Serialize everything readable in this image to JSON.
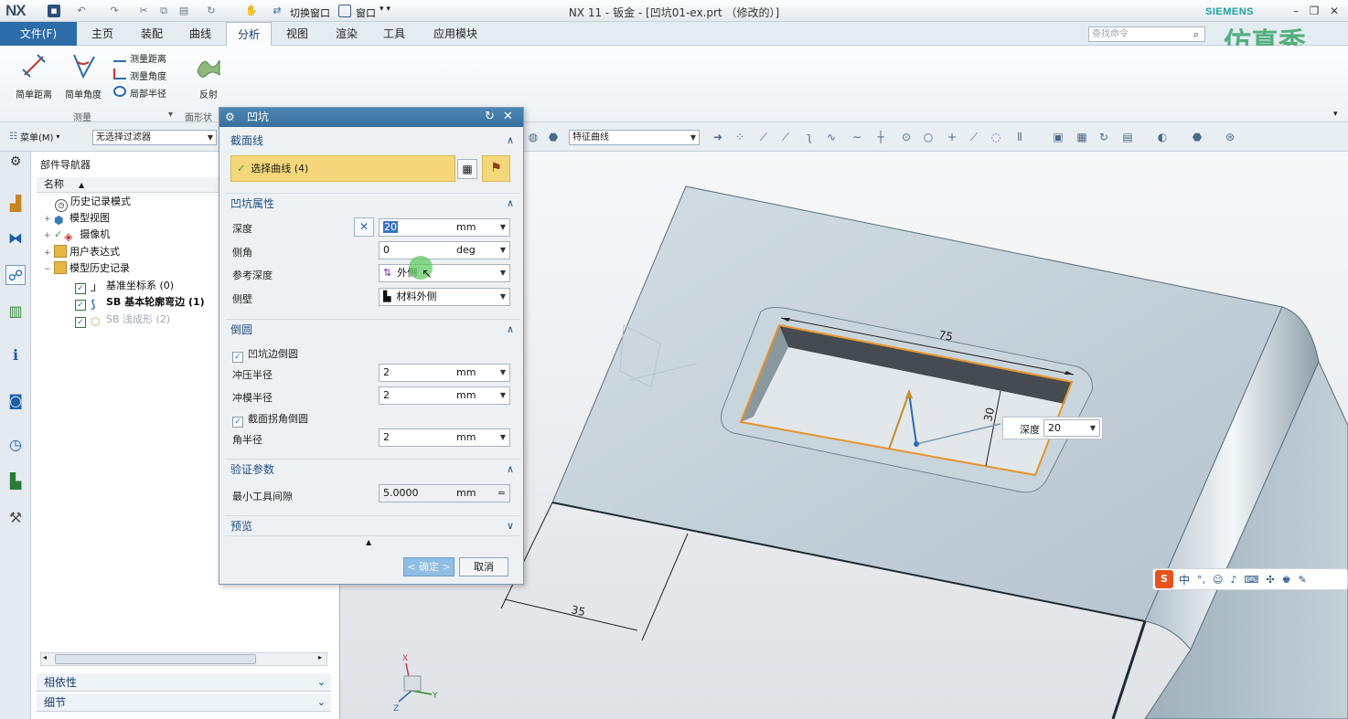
{
  "window": {
    "logo": "NX",
    "title": "NX 11 - 钣金 - [凹坑01-ex.prt （修改的）]",
    "brand": "SIEMENS",
    "watermark": "仿真秀",
    "quick_access": [
      "切换窗口",
      "窗口"
    ]
  },
  "menu": {
    "file": "文件(F)",
    "tabs": [
      "主页",
      "装配",
      "曲线",
      "分析",
      "视图",
      "渲染",
      "工具",
      "应用模块"
    ],
    "active_tab": "分析",
    "search_placeholder": "查找命令"
  },
  "ribbon": {
    "big_buttons": [
      "简单距离",
      "简单角度"
    ],
    "small_buttons": [
      "测量距离",
      "测量角度",
      "局部半径"
    ],
    "reflect_button": "反射",
    "group_measure": "测量",
    "group_shape": "面形状"
  },
  "toolbar": {
    "menu_label": "菜单(M)",
    "filter_value": "无选择过滤器",
    "curve_rule": "特征曲线"
  },
  "navigator": {
    "title": "部件导航器",
    "column_name": "名称",
    "items": [
      {
        "label": "历史记录模式"
      },
      {
        "label": "模型视图"
      },
      {
        "label": "摄像机"
      },
      {
        "label": "用户表达式"
      },
      {
        "label": "模型历史记录"
      },
      {
        "label": "基准坐标系 (0)"
      },
      {
        "label": "SB 基本轮廓弯边 (1)"
      },
      {
        "label": "SB 浅成形 (2)"
      }
    ],
    "panels": [
      "相依性",
      "细节"
    ]
  },
  "dialog": {
    "title": "凹坑",
    "section_curve": "截面线",
    "select_curve": "选择曲线 (4)",
    "section_props": "凹坑属性",
    "depth_label": "深度",
    "depth_value": "20",
    "depth_unit": "mm",
    "draft_label": "侧角",
    "draft_value": "0",
    "draft_unit": "deg",
    "ref_depth_label": "参考深度",
    "ref_depth_value": "外侧",
    "side_wall_label": "侧壁",
    "side_wall_value": "材料外侧",
    "section_round": "倒圆",
    "edge_round_label": "凹坑边倒圆",
    "punch_radius_label": "冲压半径",
    "punch_radius_value": "2",
    "die_radius_label": "冲模半径",
    "die_radius_value": "2",
    "corner_round_label": "截面拐角倒圆",
    "corner_radius_label": "角半径",
    "corner_radius_value": "2",
    "section_verify": "验证参数",
    "min_tool_label": "最小工具间隙",
    "min_tool_value": "5.0000",
    "min_tool_unit": "mm",
    "section_preview": "预览",
    "ok": "< 确定 >",
    "cancel": "取消"
  },
  "viewport": {
    "dim_top": "75",
    "dim_side": "30",
    "dim_bottom": "35",
    "depth_tag_label": "深度",
    "depth_tag_value": "20",
    "triad": [
      "X",
      "Y",
      "Z"
    ],
    "ime": "中"
  }
}
